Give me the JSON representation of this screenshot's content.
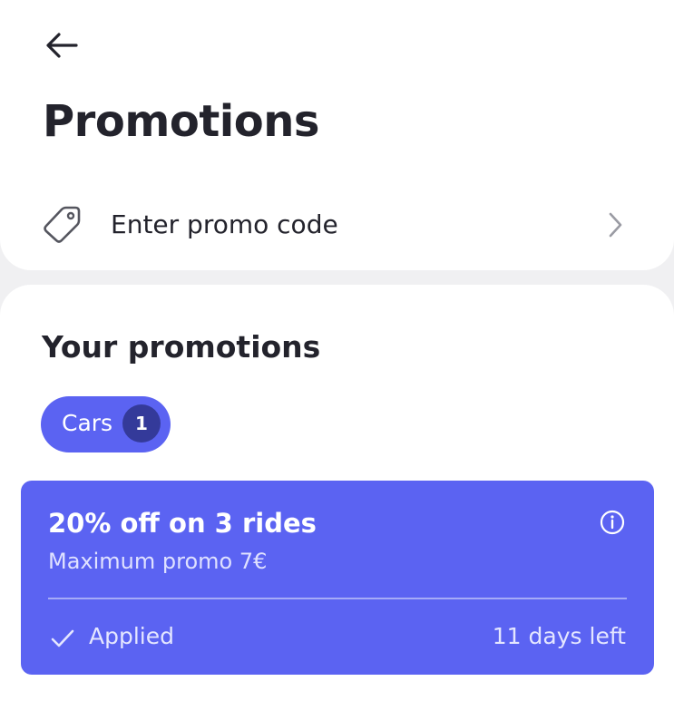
{
  "header": {
    "title": "Promotions",
    "back_icon": "arrow-left-icon"
  },
  "promo_entry": {
    "label": "Enter promo code",
    "leading_icon": "tag-icon",
    "trailing_icon": "chevron-right-icon"
  },
  "your_promotions": {
    "title": "Your promotions",
    "filters": [
      {
        "label": "Cars",
        "count": "1"
      }
    ],
    "promos": [
      {
        "title": "20% off on 3 rides",
        "subtitle": "Maximum promo 7€",
        "status": "Applied",
        "expiry": "11 days left"
      }
    ]
  },
  "colors": {
    "accent": "#5b63f2",
    "badge": "#343a9a",
    "background": "#f0f0f2",
    "text": "#23232c"
  }
}
